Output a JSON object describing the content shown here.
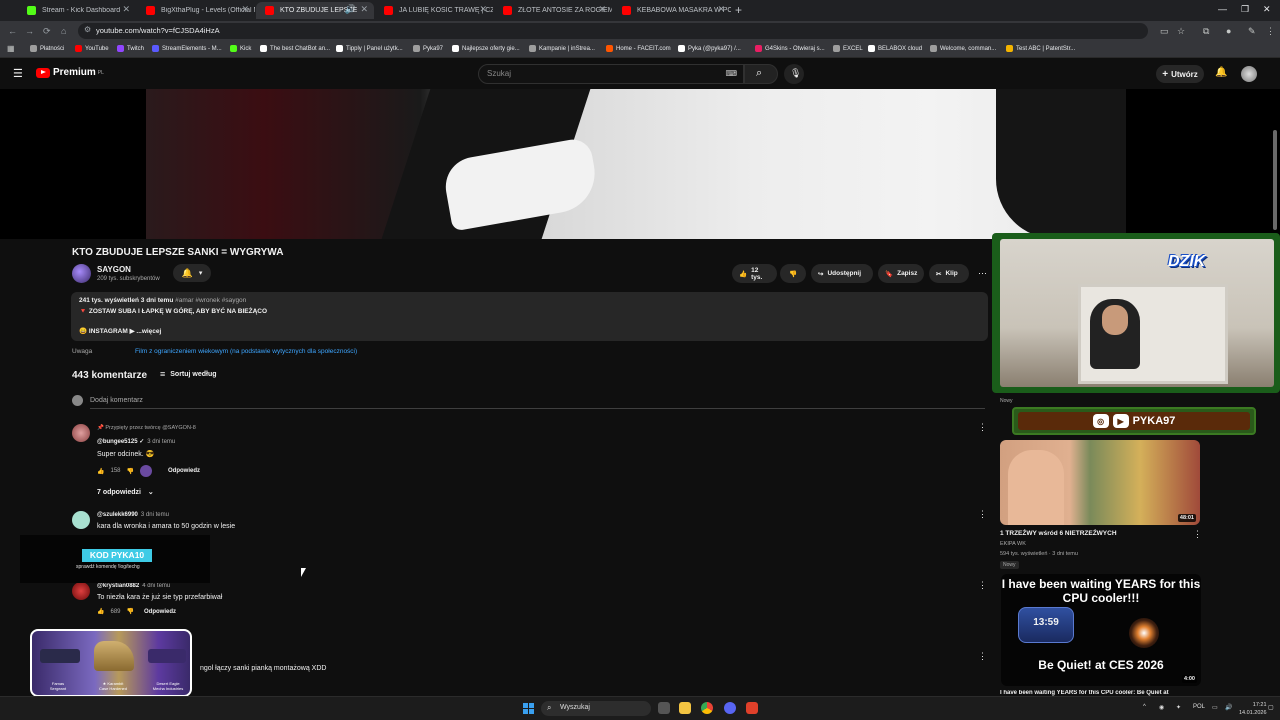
{
  "browser": {
    "tabs": [
      {
        "label": "Stream - Kick Dashboard",
        "color": "#53fc18"
      },
      {
        "label": "BigXthaPlug - Levels (Official M",
        "color": "#ff0000"
      },
      {
        "label": "KTO ZBUDUJE LEPSZE SAN",
        "color": "#ff0000"
      },
      {
        "label": "JA LUBIĘ KOSIĆ TRAWĘ | CZAR",
        "color": "#ff0000"
      },
      {
        "label": "ZŁOTE ANTOSIE ZA ROGIEM!!",
        "color": "#ff0000"
      },
      {
        "label": "KEBABOWA MASAKRA W POZN",
        "color": "#ff0000"
      }
    ],
    "new_tab": "+",
    "url": "youtube.com/watch?v=fCJSDA4iHzA",
    "bookmarks": [
      {
        "label": "Płatności",
        "color": "#9e9e9e"
      },
      {
        "label": "YouTube",
        "color": "#ff0000"
      },
      {
        "label": "Twitch",
        "color": "#9146ff"
      },
      {
        "label": "StreamElements - M...",
        "color": "#5a5aff"
      },
      {
        "label": "Kick",
        "color": "#53fc18"
      },
      {
        "label": "The best ChatBot an...",
        "color": "#ffffff"
      },
      {
        "label": "Tipply | Panel użytk...",
        "color": "#ffffff"
      },
      {
        "label": "Pyka97",
        "color": "#9e9e9e"
      },
      {
        "label": "Najlepsze oferty gie...",
        "color": "#ffffff"
      },
      {
        "label": "Kampanie | inStrea...",
        "color": "#9e9e9e"
      },
      {
        "label": "Home - FACEIT.com",
        "color": "#ff5500"
      },
      {
        "label": "Pyka (@pyka97) /...",
        "color": "#ffffff"
      },
      {
        "label": "G4Skins - Otwieraj s...",
        "color": "#e91e63"
      },
      {
        "label": "EXCEL",
        "color": "#9e9e9e"
      },
      {
        "label": "BELABOX cloud",
        "color": "#ffffff"
      },
      {
        "label": "Welcome, comman...",
        "color": "#9e9e9e"
      },
      {
        "label": "Test ABC | PatentStr...",
        "color": "#f4b400"
      }
    ]
  },
  "masthead": {
    "logo": "Premium",
    "logo_region": "PL",
    "search_placeholder": "Szukaj",
    "create_label": "Utwórz"
  },
  "video": {
    "title": "KTO ZBUDUJE LEPSZE SANKI = WYGRYWA",
    "channel": "SAYGON",
    "subscribers": "209 tys. subskrybentów",
    "likes": "12 tys.",
    "share_label": "Udostępnij",
    "save_label": "Zapisz",
    "clip_label": "Klip",
    "views_line": "241 tys. wyświetleń  3 dni temu",
    "hashtags": "#amar #wronek #saygon",
    "desc_line": "🔻 ZOSTAW SUBA I ŁAPKĘ W GÓRĘ, ABY BYĆ NA BIEŻĄCO",
    "insta_line": "😄 INSTAGRAM ▶",
    "more_label": "...więcej",
    "warning_label": "Uwaga",
    "warning_text": "Film z ograniczeniem wiekowym (na podstawie wytycznych dla społeczności)"
  },
  "comments": {
    "count_label": "443 komentarze",
    "sort_label": "Sortuj według",
    "add_placeholder": "Dodaj komentarz",
    "items": [
      {
        "pinned": "📌 Przypięty przez twórcę @SAYGON-8",
        "author": "@bungee5125 ✓",
        "time": "3 dni temu",
        "text": "Super odcinek. 😎",
        "likes": "158",
        "reply": "Odpowiedz",
        "replies": "7 odpowiedzi"
      },
      {
        "author": "@szulekk6990",
        "time": "3 dni temu",
        "text": "kara dla wronka i amara to 50 godzin w lesie"
      },
      {
        "author": "@krystian0882",
        "time": "4 dni temu",
        "text": "To niezła kara że już sie typ przefarbiwał",
        "likes": "689",
        "reply": "Odpowiedz"
      },
      {
        "text": "ngol łączy sanki pianką montażową XDD"
      }
    ]
  },
  "overlays": {
    "code_label": "KOD PYKA10",
    "code_sub": "sprawdź komendę !log/techg",
    "skins": [
      "Famas",
      "★ Karambit",
      "Desert Eagle"
    ],
    "skin_subs": [
      "Sergeant",
      "Case Hardened",
      "Mecha Industries"
    ],
    "streamer_logo": "DZIK",
    "social_handle": "PYKA97",
    "cam_corner_label": "Nowy"
  },
  "sidebar": {
    "rec1": {
      "title": "1 TRZEŹWY wśród 6 NIETRZEŹWYCH",
      "channel": "EKIPA WK",
      "meta": "594 tys. wyświetleń · 3 dni temu",
      "badge": "Nowy",
      "duration": "48:01"
    },
    "rec2": {
      "thumb_line1": "I have been waiting YEARS for this CPU cooler!!!",
      "thumb_line2": "Be Quiet! at CES 2026",
      "timer": "13:59",
      "title": "I have been waiting YEARS for this CPU cooler: Be Quiet at",
      "duration": "4:00"
    }
  },
  "taskbar": {
    "search_label": "Wyszukaj",
    "lang": "POL",
    "time": "17:21",
    "date": "14.01.2026"
  }
}
